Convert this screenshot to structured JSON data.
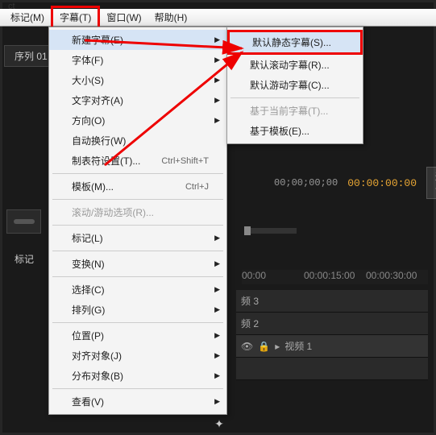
{
  "app": {
    "title_frag": "ct"
  },
  "menubar": {
    "items": [
      "标记(M)",
      "字幕(T)",
      "窗口(W)",
      "帮助(H)"
    ],
    "active_index": 1
  },
  "tab": {
    "label": "序列 01",
    "close": "×"
  },
  "dropdown": {
    "groups": [
      [
        {
          "label": "新建字幕(E)",
          "has_sub": true,
          "hover": true
        },
        {
          "label": "字体(F)",
          "has_sub": true
        },
        {
          "label": "大小(S)",
          "has_sub": true
        },
        {
          "label": "文字对齐(A)",
          "has_sub": true
        },
        {
          "label": "方向(O)",
          "has_sub": true
        },
        {
          "label": "自动换行(W)"
        },
        {
          "label": "制表符设置(T)...",
          "shortcut": "Ctrl+Shift+T"
        }
      ],
      [
        {
          "label": "模板(M)...",
          "shortcut": "Ctrl+J"
        }
      ],
      [
        {
          "label": "滚动/游动选项(R)...",
          "disabled": true
        }
      ],
      [
        {
          "label": "标记(L)",
          "has_sub": true
        }
      ],
      [
        {
          "label": "变换(N)",
          "has_sub": true
        }
      ],
      [
        {
          "label": "选择(C)",
          "has_sub": true
        },
        {
          "label": "排列(G)",
          "has_sub": true
        }
      ],
      [
        {
          "label": "位置(P)",
          "has_sub": true
        },
        {
          "label": "对齐对象(J)",
          "has_sub": true
        },
        {
          "label": "分布对象(B)",
          "has_sub": true
        }
      ],
      [
        {
          "label": "查看(V)",
          "has_sub": true
        }
      ]
    ]
  },
  "submenu": {
    "items": [
      {
        "label": "默认静态字幕(S)...",
        "highlighted": true
      },
      {
        "label": "默认滚动字幕(R)..."
      },
      {
        "label": "默认游动字幕(C)..."
      }
    ],
    "sep_after": 2,
    "tail": [
      {
        "label": "基于当前字幕(T)...",
        "disabled": true
      },
      {
        "label": "基于模板(E)..."
      }
    ]
  },
  "timecode": {
    "t1": "00;00;00;00",
    "t2": "00:00:00:00",
    "fit": "适合"
  },
  "marker_label": "标记",
  "ruler": [
    "00:00",
    "00:00:15:00",
    "00:00:30:00"
  ],
  "tracks": [
    {
      "label": "频 3"
    },
    {
      "label": "频 2"
    },
    {
      "label": "视频 1",
      "header": true
    }
  ],
  "icons": {
    "cursor": "↖",
    "hand": "✋",
    "text": "T",
    "pen": "✎",
    "rect": "▭",
    "wand": "✦",
    "line": "／",
    "chevron": "▸",
    "eye": "👁",
    "lock": "🔒"
  }
}
